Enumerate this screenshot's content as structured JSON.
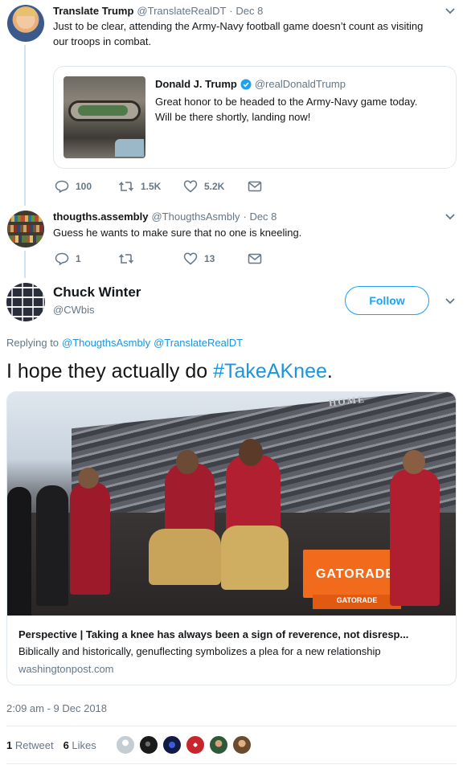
{
  "tweet1": {
    "name": "Translate Trump",
    "handle": "@TranslateRealDT",
    "date": "· Dec 8",
    "text_line1": "Just to be clear, attending the Army-Navy football game doesn’t count as visiting",
    "text_line2": "our troops in combat.",
    "quote": {
      "name": "Donald J. Trump",
      "verified_icon": "verified-badge-icon",
      "handle": "@realDonaldTrump",
      "text_line1": "Great honor to be headed to the Army-Navy game today.",
      "text_line2": "Will be there shortly, landing now!"
    },
    "replies": "100",
    "retweets": "1.5K",
    "likes": "5.2K"
  },
  "tweet2": {
    "name": "thougths.assembly",
    "handle": "@ThougthsAsmbly",
    "date": "· Dec 8",
    "text": "Guess he wants to make sure that no one is kneeling.",
    "replies": "1",
    "retweets": "",
    "likes": "13"
  },
  "main_tweet": {
    "name": "Chuck Winter",
    "handle": "@CWbis",
    "follow_label": "Follow",
    "replying_prefix": "Replying to",
    "replying_to_1": "@ThougthsAsmbly",
    "replying_to_2": "@TranslateRealDT",
    "text_before": "I hope they actually do ",
    "hashtag": "#TakeAKnee",
    "text_after": ".",
    "card": {
      "image_text_1": "GATORADE",
      "image_text_2": "GATORADE",
      "image_text_3": "HOME",
      "title": "Perspective | Taking a knee has always been a sign of reverence, not disresp...",
      "description": "Biblically and historically, genuflecting symbolizes a plea for a new relationship",
      "domain": "washingtonpost.com"
    },
    "timestamp": "2:09 am - 9 Dec 2018",
    "retweet_count": "1",
    "retweet_label": "Retweet",
    "like_count": "6",
    "like_label": "Likes"
  },
  "colors": {
    "accent": "#1da1f2",
    "link": "#1b95e0",
    "muted": "#657786",
    "thread_line": "#cfe3f3"
  }
}
